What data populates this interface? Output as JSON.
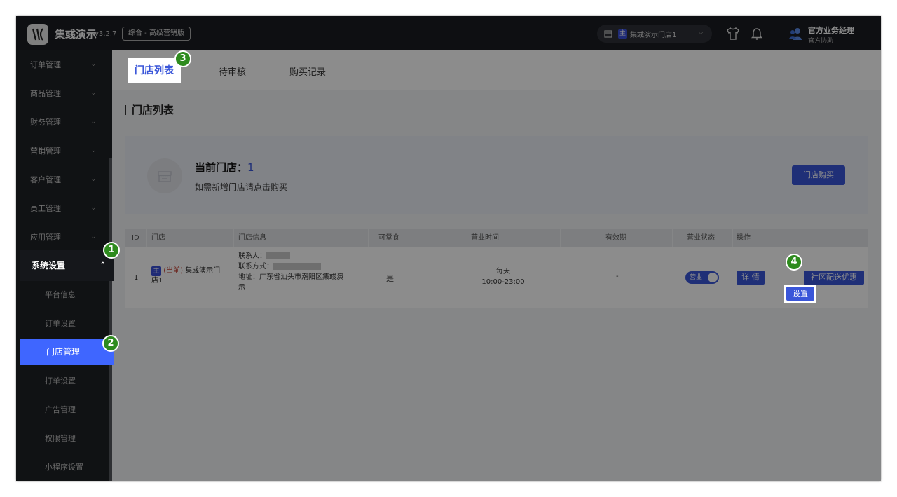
{
  "header": {
    "brand": "集彧演示",
    "version": "v3.2.7",
    "edition": "综合 - 高级营销版",
    "store_select": {
      "badge": "主",
      "name": "集彧演示门店1"
    },
    "user": {
      "name": "官方业务经理",
      "role": "官方协助"
    }
  },
  "sidebar": {
    "menus": [
      {
        "label": "订单管理"
      },
      {
        "label": "商品管理"
      },
      {
        "label": "财务管理"
      },
      {
        "label": "营销管理"
      },
      {
        "label": "客户管理"
      },
      {
        "label": "员工管理"
      },
      {
        "label": "应用管理"
      }
    ],
    "active_menu": "系统设置",
    "sub_items": [
      {
        "label": "平台信息"
      },
      {
        "label": "订单设置"
      },
      {
        "label": "门店管理"
      },
      {
        "label": "打单设置"
      },
      {
        "label": "广告管理"
      },
      {
        "label": "权限管理"
      },
      {
        "label": "小程序设置"
      }
    ]
  },
  "tabs": [
    {
      "label": "门店列表"
    },
    {
      "label": "待审核"
    },
    {
      "label": "购买记录"
    }
  ],
  "page": {
    "title": "门店列表",
    "current_store_label": "当前门店：",
    "current_store_count": "1",
    "hint": "如需新增门店请点击购买",
    "buy_button": "门店购买"
  },
  "table": {
    "columns": [
      "ID",
      "门店",
      "门店信息",
      "可堂食",
      "营业时间",
      "有效期",
      "营业状态",
      "操作"
    ],
    "rows": [
      {
        "id": "1",
        "badge": "主",
        "current": "(当前)",
        "store_name_1": "集彧演示门",
        "store_name_2": "店1",
        "contact_label": "联系人：",
        "phone_label": "联系方式：",
        "address_1": "地址：广东省汕头市潮阳区集彧演",
        "address_2": "示",
        "dine_in": "是",
        "hours_1": "每天",
        "hours_2": "10:00-23:00",
        "validity": "-",
        "status": "营业",
        "actions": [
          "详 情",
          "设置",
          "社区配送优惠"
        ]
      }
    ]
  },
  "steps": [
    "1",
    "2",
    "3",
    "4"
  ],
  "colors": {
    "accent": "#3a56d9",
    "step": "#2e8b1e",
    "sidebar": "#1e2126",
    "topbar": "#1b1d22"
  }
}
